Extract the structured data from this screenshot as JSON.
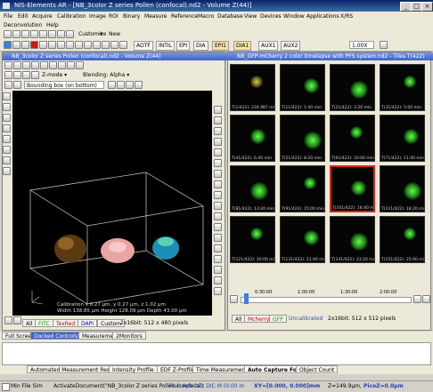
{
  "app": {
    "title": "NIS-Elements AR - [NB_3color Z series Pollen (confocal).nd2 - Volume  Z(44)]"
  },
  "menu": [
    "File",
    "Edit",
    "Acquire",
    "Calibration",
    "Image",
    "ROI",
    "Binary",
    "Measure",
    "Reference",
    "Macro",
    "Database",
    "View",
    "Devices",
    "Window",
    "Applications",
    "X/RS",
    "Deconvolution",
    "Help"
  ],
  "toolbar2": {
    "customize_label": "Customize",
    "new_label": "New",
    "lamps": [
      "AOTF",
      "INTIL",
      "EPI",
      "DIA",
      "EPI1",
      "DIA1",
      "AUX1",
      "AUX2"
    ],
    "zoom": "1.00X"
  },
  "volume_doc": {
    "title": "NB_3color Z series Pollen (confocal).nd2 - Volume  Z(44)",
    "zmode_label": "Z-mode",
    "blending_label": "Blending: Alpha",
    "bounding_label": "Bounding box (on bottom)",
    "calibration_text": "Calibration x 0.27 μm, y 0.27 μm, z 1.02 μm",
    "size_text": "Width 138.85 μm Height 128.09 μm Depth 43.00 μm",
    "bottom_tabs": [
      "All",
      "FITC",
      "TexRed",
      "DAPI",
      "Custom"
    ],
    "bottom_info": "2x16bit: 512 x 480 pixels"
  },
  "tiles_doc": {
    "title": "NB_GFP-mCherry 2 color timelapse with PFS system.nd2 - Tiles  T(422)",
    "tiles": [
      "T(1/422): 234.987 msec",
      "T(11/422): 1:40 min",
      "T(21/422): 3:20 min",
      "T(31/422): 5:00 min",
      "T(41/422): 6:40 min",
      "T(51/422): 8:20 min",
      "T(61/422): 10:00 min",
      "T(71/422): 11:40 min",
      "T(81/422): 13:20 min",
      "T(91/422): 15:00 min",
      "T(101/422): 16:40 min",
      "T(111/422): 18:20 min",
      "T(121/422): 20:00 min",
      "T(131/422): 21:40 min",
      "T(141/422): 23:20 min",
      "T(151/422): 25:00 min"
    ],
    "timeline_labels": [
      "0:30:00",
      "1:00:00",
      "1:30:00",
      "2:00:00"
    ],
    "bottom_tabs": [
      "All",
      "Mcherry",
      "GFP",
      "Uncalibrated"
    ],
    "bottom_info": "2x16bit: 512 x 512 pixels"
  },
  "dock_tabs": [
    "Full Screen",
    "Docked Controls*",
    "Measurement",
    "2Monitors"
  ],
  "lower_tabs": [
    "Automated Measurement Results",
    "Intensity Profile",
    "EDF Z-Profile",
    "Time Measurement",
    "Auto Capture Folder",
    "Object Count"
  ],
  "status": {
    "left": "Min File Sim",
    "doc": "ActivateDocument(\"NB_3color Z series Pollen (confocal)",
    "objective": "Plan Apo 20x DIC M (0.00 m",
    "xyz": "XY=[0.000, 0.000]mm",
    "z": "Z=149.9μm,",
    "picoz": "PicoZ=0.0μm"
  }
}
